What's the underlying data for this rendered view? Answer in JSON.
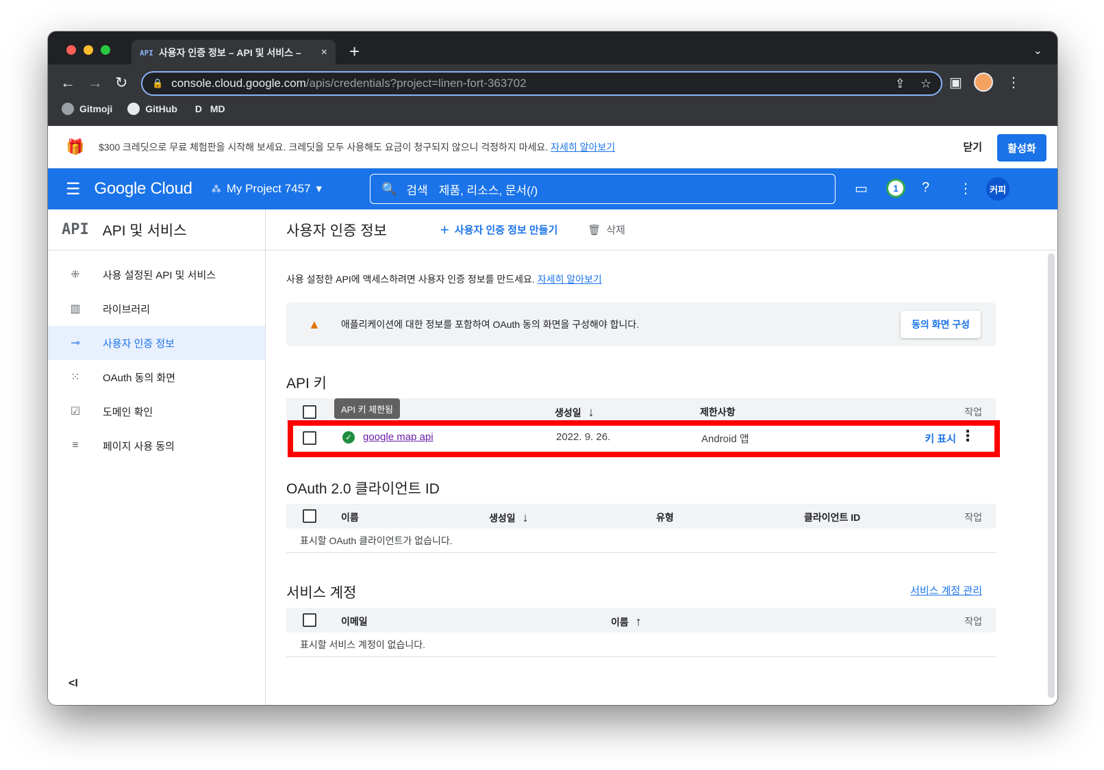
{
  "browser": {
    "tab_favicon": "API",
    "tab_title": "사용자 인증 정보 – API 및 서비스 –",
    "tab_close": "×",
    "new_tab": "+",
    "url_host": "console.cloud.google.com",
    "url_path": "/apis/credentials?project=linen-fort-363702",
    "bookmarks": [
      "Gitmoji",
      "GitHub",
      "MD"
    ],
    "bookmark_d": "D"
  },
  "trial_banner": {
    "text": "$300 크레딧으로 무료 체험판을 시작해 보세요. 크레딧을 모두 사용해도 요금이 청구되지 않으니 걱정하지 마세요.",
    "link": "자세히 알아보기",
    "close": "닫기",
    "activate": "활성화"
  },
  "header": {
    "logo": "Google Cloud",
    "project": "My Project 7457",
    "search_label": "검색",
    "search_placeholder": "제품, 리소스, 문서(/)",
    "notification_count": "1",
    "account": "커피"
  },
  "sidebar": {
    "api_badge": "API",
    "title": "API 및 서비스",
    "items": [
      {
        "label": "사용 설정된 API 및 서비스",
        "icon": "api-hub-icon"
      },
      {
        "label": "라이브러리",
        "icon": "library-icon"
      },
      {
        "label": "사용자 인증 정보",
        "icon": "key-icon"
      },
      {
        "label": "OAuth 동의 화면",
        "icon": "oauth-icon"
      },
      {
        "label": "도메인 확인",
        "icon": "checkbox-icon"
      },
      {
        "label": "페이지 사용 동의",
        "icon": "settings-list-icon"
      }
    ],
    "collapse": "<I"
  },
  "main": {
    "title": "사용자 인증 정보",
    "create": "사용자 인증 정보 만들기",
    "delete": "삭제",
    "intro_text": "사용 설정한 API에 액세스하려면 사용자 인증 정보를 만드세요.",
    "intro_link": "자세히 알아보기",
    "warning_text": "애플리케이션에 대한 정보를 포함하여 OAuth 동의 화면을 구성해야 합니다.",
    "consent_button": "동의 화면 구성",
    "api_keys": {
      "title": "API 키",
      "tooltip": "API 키 제한됨",
      "col_created": "생성일",
      "col_restrictions": "제한사항",
      "col_actions": "작업",
      "row": {
        "name": "google map api",
        "created": "2022. 9. 26.",
        "restriction": "Android 앱",
        "show_key": "키 표시"
      }
    },
    "oauth": {
      "title": "OAuth 2.0 클라이언트 ID",
      "col_name": "이름",
      "col_created": "생성일",
      "col_type": "유형",
      "col_client_id": "클라이언트 ID",
      "col_actions": "작업",
      "empty": "표시할 OAuth 클라이언트가 없습니다."
    },
    "service_accounts": {
      "title": "서비스 계정",
      "manage": "서비스 계정 관리",
      "col_email": "이메일",
      "col_name": "이름",
      "col_actions": "작업",
      "empty": "표시할 서비스 계정이 없습니다."
    }
  },
  "colors": {
    "brand_blue": "#1a73e8",
    "highlight_red": "#ff0000",
    "success_green": "#1e8e3e",
    "warning_orange": "#e37400"
  }
}
